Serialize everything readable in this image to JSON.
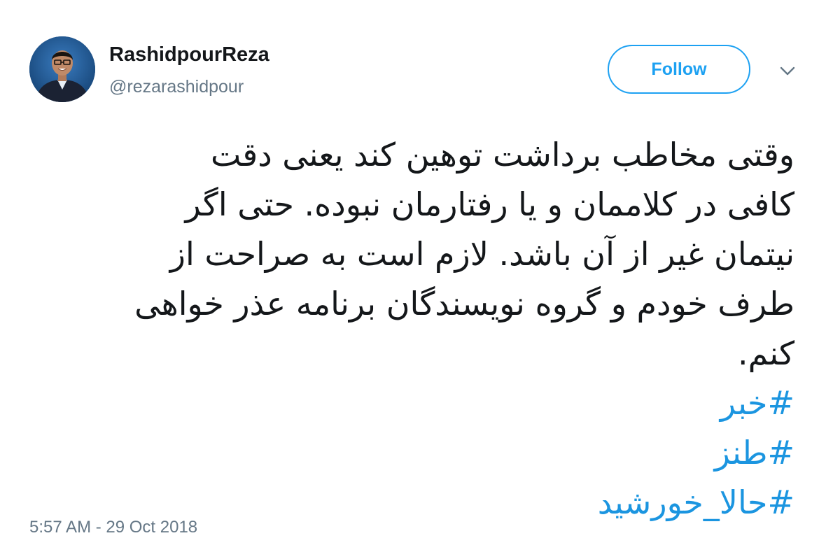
{
  "user": {
    "display_name": "RashidpourReza",
    "handle": "@rezarashidpour",
    "avatar_icon": "profile-photo"
  },
  "follow_button": {
    "label": "Follow",
    "color": "#1da1f2"
  },
  "menu_icon": "chevron-down-icon",
  "tweet": {
    "lines": [
      "وقتی مخاطب برداشت توهین کند یعنی دقت",
      "کافی در کلاممان و یا رفتارمان نبوده. حتی اگر",
      "نیتمان غیر از آن باشد. لازم است به صراحت از",
      "طرف خودم و گروه نویسندگان برنامه عذر خواهی",
      "کنم."
    ],
    "hashtags": [
      "#خبر",
      "#طنز",
      "#حالا_خورشید"
    ],
    "hashtag_color": "#1b95e0"
  },
  "timestamp": "5:57 AM - 29 Oct 2018"
}
